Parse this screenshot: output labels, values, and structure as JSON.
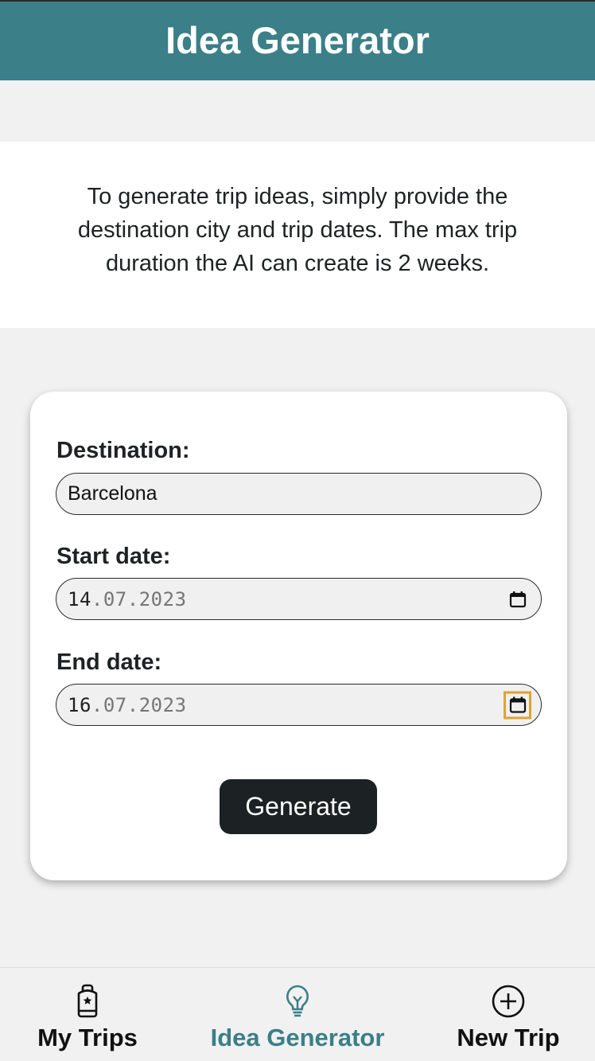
{
  "header": {
    "title": "Idea Generator"
  },
  "intro": {
    "text": "To generate trip ideas, simply provide the destination city and trip dates. The max trip duration the AI can create is 2 weeks."
  },
  "form": {
    "destination": {
      "label": "Destination:",
      "value": "Barcelona"
    },
    "start_date": {
      "label": "Start date:",
      "day": "14",
      "sep1": ".",
      "month": "07",
      "sep2": ".",
      "year": "2023"
    },
    "end_date": {
      "label": "End date:",
      "day": "16",
      "sep1": ".",
      "month": "07",
      "sep2": ".",
      "year": "2023"
    },
    "generate_label": "Generate"
  },
  "nav": {
    "items": [
      {
        "label": "My Trips",
        "icon": "luggage-star-icon",
        "active": false
      },
      {
        "label": "Idea Generator",
        "icon": "lightbulb-icon",
        "active": true
      },
      {
        "label": "New Trip",
        "icon": "plus-circle-icon",
        "active": false
      }
    ]
  },
  "colors": {
    "header_bg": "#3b7f88",
    "active_nav": "#3b7f88",
    "button_bg": "#1c2223",
    "focus_outline": "#e3a230"
  }
}
